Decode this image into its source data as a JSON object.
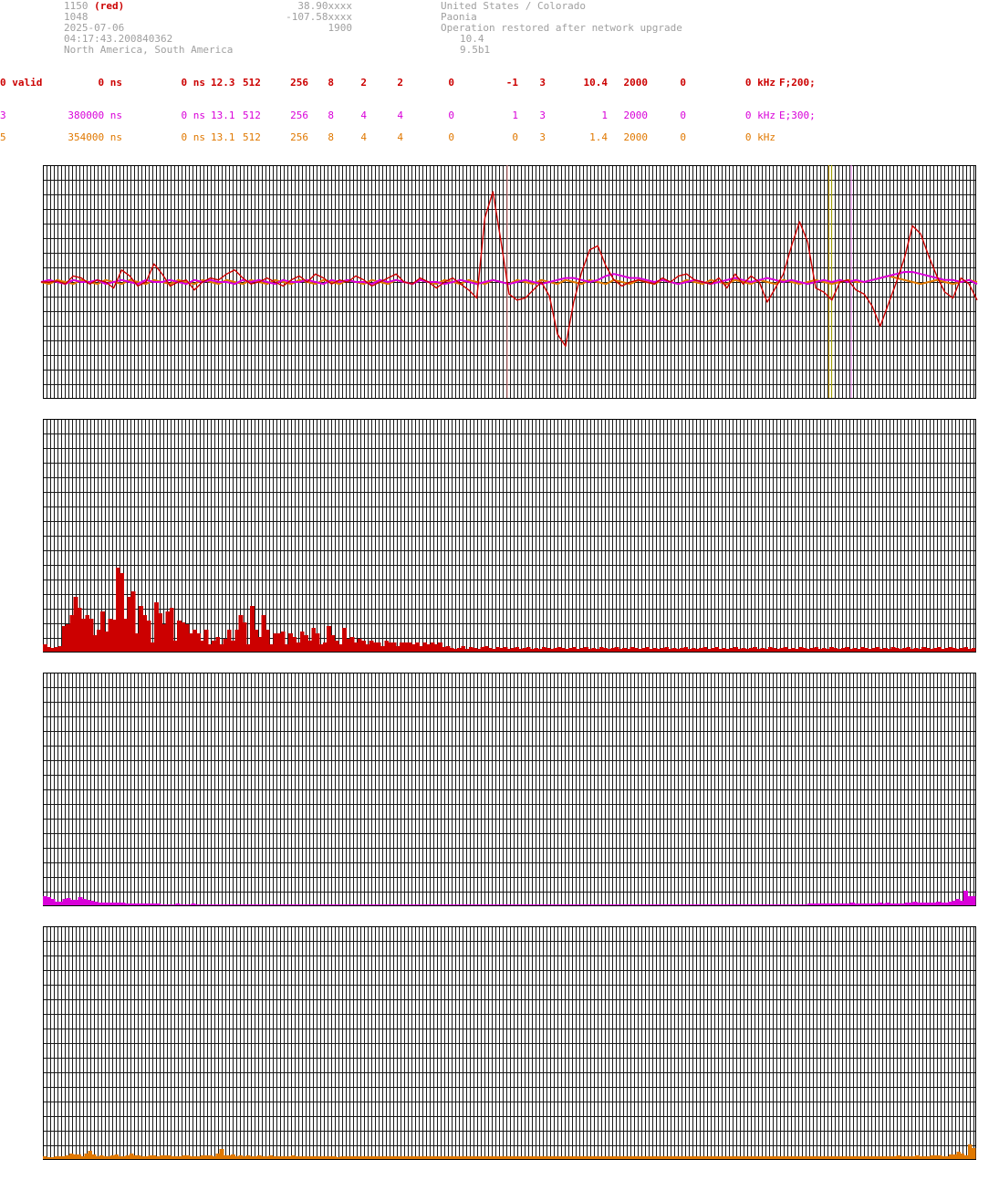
{
  "header": {
    "left": [
      "1150",
      "1048",
      "2025-07-06",
      "04:17:43.200840362",
      "North America, South America"
    ],
    "left_red": "(red)",
    "mid": [
      "38.90xxxx",
      "-107.58xxxx",
      "1900"
    ],
    "right": [
      "United States / Colorado",
      "Paonia",
      "Operation restored after network upgrade"
    ],
    "right_indent": [
      "10.4",
      "9.5b1"
    ]
  },
  "rows": [
    {
      "color": "#cc0000",
      "cells": [
        "0 valid",
        "0 ns",
        "0 ns",
        "12.3",
        "512",
        "256",
        "8",
        "2",
        "2",
        "0",
        "-1",
        "3",
        "10.4",
        "2000",
        "0",
        "0 kHz",
        "F;200;"
      ]
    },
    {
      "color": "#d900d9",
      "cells": [
        "3",
        "380000 ns",
        "0 ns",
        "13.1",
        "512",
        "256",
        "8",
        "4",
        "4",
        "0",
        "1",
        "3",
        "1",
        "2000",
        "0",
        "0 kHz",
        "E;300;"
      ]
    },
    {
      "color": "#e07800",
      "cells": [
        "5",
        "354000 ns",
        "0 ns",
        "13.1",
        "512",
        "256",
        "8",
        "4",
        "4",
        "0",
        "0",
        "3",
        "1.4",
        "2000",
        "0",
        "0 kHz",
        ""
      ]
    }
  ],
  "chart_data": [
    {
      "type": "line",
      "series": [
        {
          "color": "#cc0000",
          "values": [
            0,
            0,
            0.05,
            -0.1,
            0.3,
            0.2,
            -0.1,
            0.1,
            0,
            -0.3,
            0.6,
            0.3,
            -0.2,
            0,
            0.9,
            0.4,
            -0.2,
            0,
            0.1,
            -0.4,
            0,
            0.2,
            0.1,
            0.4,
            0.6,
            0.2,
            -0.1,
            0,
            0.2,
            0,
            -0.2,
            0.1,
            0.3,
            0,
            0.4,
            0.2,
            -0.1,
            0.1,
            0,
            0.3,
            0.1,
            -0.2,
            0,
            0.2,
            0.4,
            0,
            -0.1,
            0.2,
            0,
            -0.3,
            0,
            0.2,
            -0.1,
            -0.4,
            -0.8,
            3.2,
            4.5,
            2.0,
            -0.6,
            -0.9,
            -0.8,
            -0.4,
            0,
            -0.7,
            -2.6,
            -3.2,
            -1.0,
            0.5,
            1.6,
            1.8,
            0.8,
            0.1,
            -0.2,
            0,
            0.1,
            0,
            -0.1,
            0.2,
            0,
            0.3,
            0.4,
            0.1,
            0,
            -0.1,
            0.2,
            -0.3,
            0.4,
            -0.1,
            0.3,
            0,
            -1.0,
            -0.3,
            0.4,
            1.8,
            3.0,
            2.0,
            -0.3,
            -0.5,
            -0.9,
            0,
            0.1,
            -0.4,
            -0.6,
            -1.2,
            -2.2,
            -1.1,
            0,
            1.2,
            2.8,
            2.4,
            1.3,
            0.3,
            -0.5,
            -0.8,
            0.2,
            -0.1,
            -0.9
          ]
        },
        {
          "color": "#d900d9",
          "values": [
            0,
            0.1,
            0,
            -0.1,
            0.1,
            0,
            0,
            0.1,
            -0.1,
            0,
            0.1,
            0,
            -0.1,
            0.1,
            0,
            0,
            0.1,
            0,
            -0.1,
            0.1,
            0,
            0.1,
            0,
            0,
            -0.1,
            0.1,
            0,
            0.1,
            0,
            -0.1,
            0.1,
            0,
            0,
            0.1,
            0,
            -0.1,
            0.1,
            0,
            0.1,
            0,
            0,
            -0.1,
            0.1,
            0,
            0.1,
            0,
            -0.1,
            0.1,
            0,
            0,
            -0.1,
            0,
            0.1,
            0,
            -0.1,
            0,
            0.1,
            0,
            -0.1,
            0,
            0.1,
            0,
            -0.1,
            0,
            0.1,
            0.2,
            0.2,
            0.1,
            0,
            0.1,
            0.3,
            0.4,
            0.3,
            0.2,
            0.2,
            0.1,
            0,
            0.1,
            0,
            -0.1,
            0,
            0.1,
            0,
            -0.1,
            0,
            0.1,
            0.2,
            0.1,
            0,
            0.1,
            0.2,
            0.1,
            0,
            0.1,
            0,
            -0.1,
            0,
            0.1,
            0,
            0.1,
            0,
            0.1,
            0,
            0.1,
            0.2,
            0.3,
            0.4,
            0.5,
            0.5,
            0.4,
            0.3,
            0.2,
            0.1,
            0.1,
            0,
            0.1,
            -0.1
          ]
        },
        {
          "color": "#e07800",
          "values": [
            0,
            -0.1,
            0.1,
            0,
            -0.1,
            0.1,
            0,
            -0.1,
            0.1,
            0,
            -0.1,
            0.1,
            0,
            -0.1,
            0.1,
            0,
            -0.1,
            0.1,
            0,
            -0.1,
            0.1,
            0,
            -0.1,
            0.1,
            0,
            -0.1,
            0.1,
            0,
            -0.1,
            0.1,
            0,
            -0.1,
            0.1,
            0,
            -0.1,
            0.1,
            0,
            -0.1,
            0.1,
            0,
            -0.1,
            0.1,
            0,
            -0.1,
            0.1,
            0,
            -0.1,
            0.1,
            0,
            -0.1,
            0.1,
            0,
            -0.1,
            0.1,
            0,
            -0.1,
            0.1,
            0,
            -0.1,
            0.1,
            0,
            -0.1,
            0.1,
            0,
            -0.1,
            0.1,
            0,
            -0.1,
            0.1,
            0,
            -0.1,
            0.1,
            0,
            -0.1,
            0.1,
            0,
            -0.1,
            0.1,
            0,
            -0.1,
            0.1,
            0,
            -0.1,
            0.1,
            0,
            -0.1,
            0.1,
            0,
            -0.1,
            0.1,
            0,
            -0.1,
            0.1,
            0,
            -0.1,
            0,
            0.1,
            0,
            -0.1,
            0,
            0.1,
            0,
            0,
            0.1,
            0.2,
            0.3,
            0.2,
            0.1,
            0,
            -0.1,
            0,
            0.1,
            0,
            -0.1,
            0,
            0.1,
            0
          ]
        }
      ],
      "markers": [
        {
          "color": "#e08080",
          "pos": 0.498
        },
        {
          "color": "#c8a000",
          "pos": 0.843
        },
        {
          "color": "#b0b000",
          "pos": 0.846
        },
        {
          "color": "#ee88ee",
          "pos": 0.867
        }
      ]
    },
    {
      "type": "bar",
      "color": "#cc0000",
      "values": [
        8,
        5,
        4,
        5,
        6,
        28,
        30,
        40,
        60,
        48,
        36,
        40,
        36,
        18,
        24,
        44,
        22,
        36,
        35,
        92,
        86,
        36,
        60,
        66,
        20,
        50,
        40,
        34,
        10,
        54,
        42,
        30,
        44,
        48,
        12,
        34,
        32,
        30,
        20,
        24,
        20,
        12,
        24,
        8,
        12,
        16,
        8,
        14,
        24,
        12,
        24,
        40,
        32,
        8,
        50,
        24,
        16,
        40,
        24,
        8,
        20,
        20,
        22,
        8,
        20,
        16,
        10,
        22,
        18,
        12,
        26,
        20,
        8,
        10,
        28,
        18,
        12,
        8,
        26,
        14,
        16,
        10,
        14,
        12,
        8,
        12,
        10,
        10,
        6,
        12,
        10,
        10,
        6,
        10,
        10,
        10,
        8,
        10,
        6,
        10,
        8,
        10,
        8,
        10,
        5,
        6,
        4,
        3,
        4,
        6,
        3,
        5,
        4,
        3,
        5,
        6,
        4,
        3,
        5,
        4,
        5,
        3,
        4,
        5,
        3,
        4,
        5,
        3,
        4,
        3,
        5,
        4,
        3,
        4,
        5,
        4,
        3,
        4,
        5,
        3,
        4,
        5,
        3,
        4,
        3,
        5,
        4,
        3,
        4,
        5,
        3,
        4,
        3,
        5,
        4,
        3,
        4,
        5,
        3,
        4,
        3,
        4,
        5,
        3,
        4,
        3,
        4,
        5,
        3,
        4,
        3,
        4,
        5,
        3,
        4,
        5,
        3,
        4,
        3,
        4,
        5,
        3,
        4,
        3,
        4,
        5,
        3,
        4,
        3,
        5,
        4,
        3,
        4,
        5,
        3,
        4,
        3,
        5,
        4,
        3,
        4,
        5,
        3,
        4,
        3,
        5,
        4,
        3,
        4,
        5,
        3,
        4,
        3,
        5,
        4,
        3,
        4,
        5,
        3,
        4,
        3,
        5,
        4,
        3,
        4,
        5,
        3,
        4,
        3,
        5,
        4,
        3,
        4,
        5,
        3,
        4,
        5,
        4,
        3,
        4,
        5,
        3,
        4
      ]
    },
    {
      "type": "bar",
      "color": "#d900d9",
      "values": [
        10,
        9,
        7,
        4,
        4,
        7,
        8,
        6,
        6,
        9,
        7,
        6,
        5,
        4,
        3,
        3,
        3,
        3,
        3,
        3,
        3,
        2,
        2,
        2,
        2,
        2,
        2,
        2,
        2,
        2,
        1,
        1,
        1,
        1,
        2,
        1,
        1,
        1,
        2,
        1,
        1,
        1,
        1,
        1,
        1,
        1,
        1,
        1,
        1,
        1,
        1,
        1,
        1,
        1,
        1,
        1,
        1,
        1,
        1,
        1,
        1,
        1,
        1,
        1,
        1,
        1,
        1,
        1,
        1,
        1,
        1,
        1,
        1,
        1,
        1,
        1,
        1,
        1,
        1,
        1,
        1,
        1,
        1,
        1,
        1,
        1,
        1,
        1,
        1,
        1,
        1,
        1,
        1,
        1,
        1,
        1,
        1,
        1,
        1,
        1,
        1,
        1,
        1,
        1,
        1,
        1,
        1,
        1,
        1,
        1,
        1,
        1,
        1,
        1,
        1,
        1,
        1,
        1,
        1,
        1,
        1,
        1,
        1,
        1,
        1,
        1,
        1,
        1,
        1,
        1,
        1,
        1,
        1,
        1,
        1,
        1,
        1,
        1,
        1,
        1,
        1,
        1,
        1,
        1,
        1,
        1,
        1,
        1,
        1,
        1,
        1,
        1,
        1,
        1,
        1,
        1,
        1,
        1,
        1,
        1,
        1,
        1,
        1,
        1,
        1,
        1,
        1,
        1,
        1,
        1,
        1,
        1,
        1,
        1,
        1,
        1,
        1,
        1,
        1,
        1,
        1,
        1,
        1,
        1,
        1,
        1,
        1,
        1,
        1,
        1,
        1,
        1,
        1,
        1,
        1,
        1,
        2,
        2,
        2,
        2,
        2,
        2,
        2,
        2,
        2,
        2,
        2,
        3,
        2,
        2,
        2,
        2,
        2,
        2,
        3,
        2,
        3,
        2,
        2,
        2,
        2,
        3,
        3,
        4,
        3,
        3,
        3,
        3,
        3,
        4,
        3,
        3,
        4,
        5,
        7,
        5,
        16,
        10,
        10
      ]
    },
    {
      "type": "bar",
      "color": "#e07800",
      "values": [
        3,
        2,
        2,
        3,
        3,
        3,
        4,
        6,
        5,
        5,
        3,
        6,
        9,
        5,
        3,
        4,
        3,
        3,
        4,
        5,
        3,
        3,
        4,
        6,
        4,
        4,
        3,
        3,
        4,
        4,
        3,
        4,
        4,
        4,
        3,
        3,
        3,
        4,
        4,
        3,
        3,
        3,
        4,
        4,
        4,
        3,
        6,
        11,
        4,
        4,
        5,
        3,
        4,
        3,
        4,
        3,
        3,
        4,
        3,
        3,
        4,
        3,
        3,
        3,
        3,
        3,
        4,
        3,
        3,
        3,
        3,
        3,
        3,
        3,
        3,
        3,
        3,
        3,
        2,
        3,
        3,
        3,
        3,
        3,
        3,
        3,
        3,
        3,
        3,
        3,
        3,
        3,
        3,
        3,
        3,
        3,
        3,
        3,
        3,
        3,
        3,
        3,
        3,
        3,
        3,
        3,
        3,
        3,
        3,
        3,
        3,
        3,
        3,
        3,
        3,
        3,
        3,
        3,
        3,
        3,
        3,
        3,
        3,
        3,
        3,
        3,
        3,
        3,
        3,
        3,
        3,
        3,
        3,
        3,
        3,
        3,
        3,
        3,
        3,
        3,
        3,
        3,
        3,
        3,
        3,
        3,
        3,
        3,
        3,
        3,
        3,
        3,
        3,
        3,
        3,
        3,
        3,
        3,
        3,
        3,
        3,
        3,
        3,
        3,
        3,
        3,
        3,
        3,
        3,
        3,
        3,
        3,
        3,
        3,
        3,
        3,
        3,
        3,
        3,
        3,
        3,
        3,
        3,
        3,
        3,
        3,
        3,
        3,
        3,
        3,
        3,
        3,
        3,
        3,
        3,
        3,
        3,
        3,
        3,
        3,
        3,
        3,
        3,
        3,
        3,
        3,
        3,
        3,
        3,
        3,
        3,
        3,
        3,
        3,
        3,
        3,
        3,
        3,
        3,
        3,
        3,
        3,
        3,
        3,
        3,
        3,
        3,
        4,
        3,
        3,
        3,
        3,
        4,
        3,
        3,
        3,
        4,
        4,
        4,
        3,
        3,
        5,
        5,
        8,
        6,
        4,
        16,
        12
      ]
    }
  ]
}
